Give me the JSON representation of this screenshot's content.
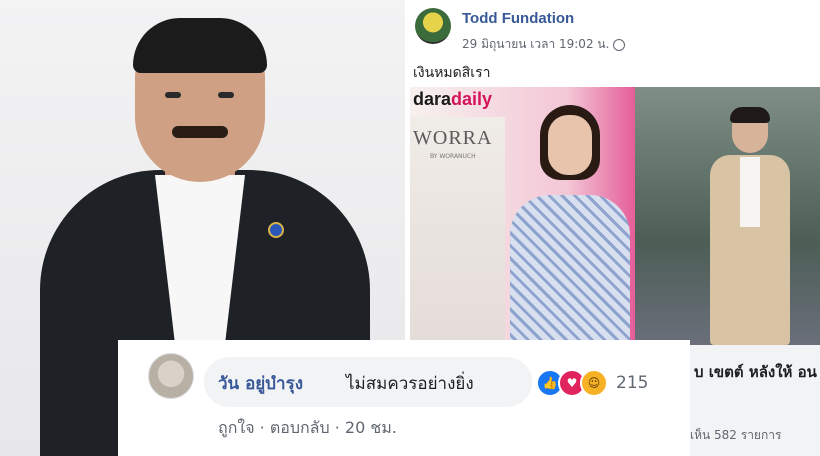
{
  "post": {
    "author": "Todd Fundation",
    "time": "29 มิถุนายน เวลา 19:02 น.",
    "text": "เงินหมดสิเรา",
    "image_logo_prefix": "dara",
    "image_logo_suffix": "daily",
    "magazine_title": "WORRA",
    "magazine_sub": "BY WORANUCH"
  },
  "article": {
    "title": "บ เขตต์ หลังให้ อน",
    "meta": "เห็น 582 รายการ"
  },
  "comment": {
    "name": "วัน อยู่บำรุง",
    "text": "ไม่สมควรอย่างยิ่ง",
    "reaction_count": "215",
    "actions": "ถูกใจ · ตอบกลับ · 20 ชม."
  },
  "colors": {
    "link_blue": "#385898",
    "like_blue": "#1877f2",
    "love_red": "#e0245e",
    "haha_yellow": "#f7b125"
  }
}
